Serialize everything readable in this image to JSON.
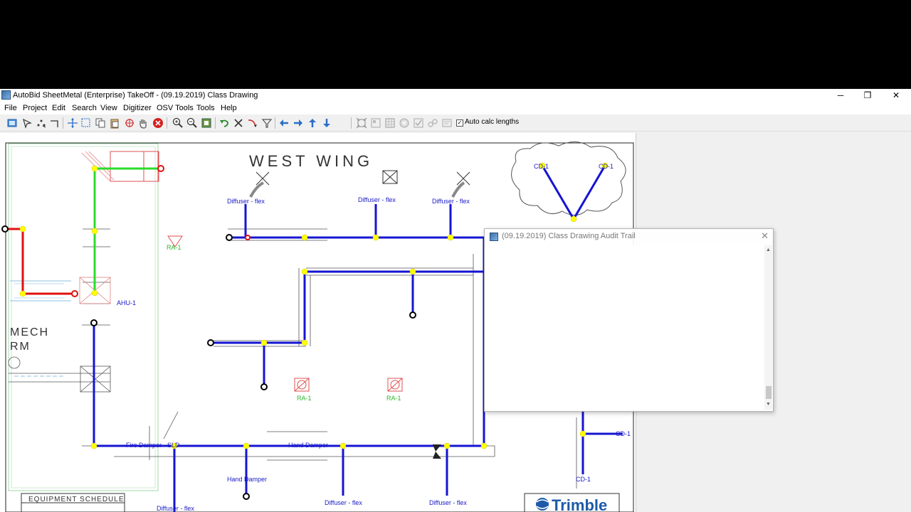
{
  "window": {
    "title": "AutoBid SheetMetal (Enterprise) TakeOff - (09.19.2019)  Class Drawing",
    "minimize": "─",
    "restore": "❐",
    "close": "✕"
  },
  "menu": [
    "File",
    "Project",
    "Edit",
    "Search",
    "View",
    "Digitizer",
    "OSV Tools",
    "Tools",
    "Help"
  ],
  "toolbar": {
    "auto_calc_label": "Auto calc lengths",
    "auto_calc_checked": true
  },
  "drawing": {
    "heading": "WEST WING",
    "room_label_1": "MECH",
    "room_label_2": "RM",
    "labels": {
      "diffuser_flex": "Diffuser - flex",
      "fire_damper": "Fire Damper - SLD",
      "hand_damper": "Hand Damper",
      "ra1": "RA-1",
      "ahu1": "AHU-1",
      "cd1": "CD-1",
      "equipment_schedule": "EQUIPMENT SCHEDULE",
      "logo": "Trimble"
    }
  },
  "dialog": {
    "title": "(09.19.2019)  Class Drawing   Audit Trail",
    "close": "✕",
    "scroll_up": "▲",
    "scroll_down": "▼"
  },
  "colors": {
    "duct_blue": "#1414d2",
    "duct_green": "#2bdc2b",
    "duct_red": "#e01010",
    "joint_yellow": "#ffff00",
    "drawing_red": "#e05050"
  }
}
